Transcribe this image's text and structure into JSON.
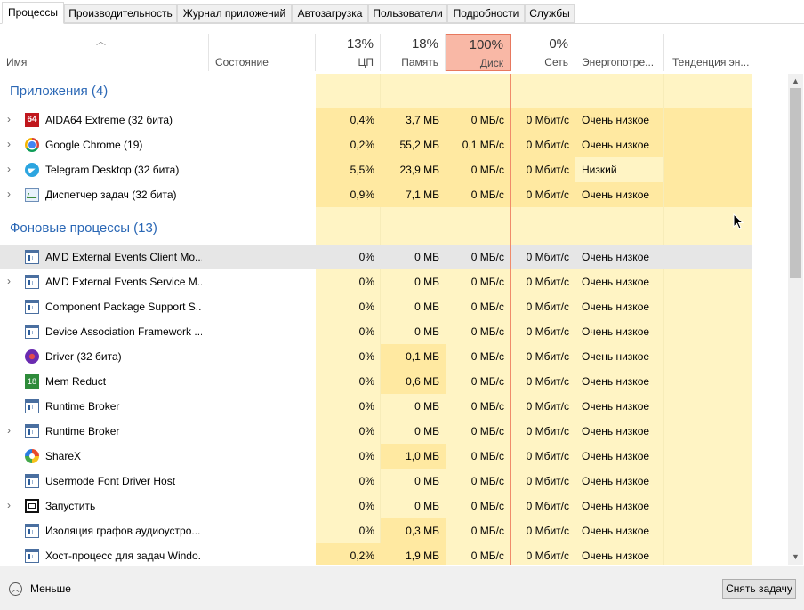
{
  "tabs": [
    {
      "label": "Процессы",
      "active": true
    },
    {
      "label": "Производительность"
    },
    {
      "label": "Журнал приложений"
    },
    {
      "label": "Автозагрузка"
    },
    {
      "label": "Пользователи"
    },
    {
      "label": "Подробности"
    },
    {
      "label": "Службы"
    }
  ],
  "header": {
    "name": "Имя",
    "status": "Состояние",
    "cpu_pct": "13%",
    "cpu": "ЦП",
    "mem_pct": "18%",
    "mem": "Память",
    "disk_pct": "100%",
    "disk": "Диск",
    "net_pct": "0%",
    "net": "Сеть",
    "energy": "Энергопотре...",
    "trend": "Тенденция эн..."
  },
  "groups": {
    "apps": "Приложения (4)",
    "bg": "Фоновые процессы (13)"
  },
  "apps": [
    {
      "name": "AIDA64 Extreme (32 бита)",
      "icon": "aida64-icon",
      "cpu": "0,4%",
      "mem": "3,7 МБ",
      "disk": "0 МБ/с",
      "net": "0 Мбит/с",
      "energy": "Очень низкое"
    },
    {
      "name": "Google Chrome (19)",
      "icon": "chrome-icon",
      "cpu": "0,2%",
      "mem": "55,2 МБ",
      "disk": "0,1 МБ/с",
      "net": "0 Мбит/с",
      "energy": "Очень низкое"
    },
    {
      "name": "Telegram Desktop (32 бита)",
      "icon": "telegram-icon",
      "cpu": "5,5%",
      "mem": "23,9 МБ",
      "disk": "0 МБ/с",
      "net": "0 Мбит/с",
      "energy": "Низкий"
    },
    {
      "name": "Диспетчер задач (32 бита)",
      "icon": "task-manager-icon",
      "cpu": "0,9%",
      "mem": "7,1 МБ",
      "disk": "0 МБ/с",
      "net": "0 Мбит/с",
      "energy": "Очень низкое"
    }
  ],
  "bg": [
    {
      "name": "AMD External Events Client Mo...",
      "icon": "service-icon",
      "cpu": "0%",
      "mem": "0 МБ",
      "disk": "0 МБ/с",
      "net": "0 Мбит/с",
      "energy": "Очень низкое"
    },
    {
      "name": "AMD External Events Service M...",
      "icon": "service-icon",
      "cpu": "0%",
      "mem": "0 МБ",
      "disk": "0 МБ/с",
      "net": "0 Мбит/с",
      "energy": "Очень низкое"
    },
    {
      "name": "Component Package Support S...",
      "icon": "service-icon",
      "cpu": "0%",
      "mem": "0 МБ",
      "disk": "0 МБ/с",
      "net": "0 Мбит/с",
      "energy": "Очень низкое"
    },
    {
      "name": "Device Association Framework ...",
      "icon": "service-icon",
      "cpu": "0%",
      "mem": "0 МБ",
      "disk": "0 МБ/с",
      "net": "0 Мбит/с",
      "energy": "Очень низкое"
    },
    {
      "name": "Driver (32 бита)",
      "icon": "driver-icon",
      "cpu": "0%",
      "mem": "0,1 МБ",
      "disk": "0 МБ/с",
      "net": "0 Мбит/с",
      "energy": "Очень низкое"
    },
    {
      "name": "Mem Reduct",
      "icon": "mem-reduct-icon",
      "cpu": "0%",
      "mem": "0,6 МБ",
      "disk": "0 МБ/с",
      "net": "0 Мбит/с",
      "energy": "Очень низкое"
    },
    {
      "name": "Runtime Broker",
      "icon": "service-icon",
      "cpu": "0%",
      "mem": "0 МБ",
      "disk": "0 МБ/с",
      "net": "0 Мбит/с",
      "energy": "Очень низкое"
    },
    {
      "name": "Runtime Broker",
      "icon": "service-icon",
      "cpu": "0%",
      "mem": "0 МБ",
      "disk": "0 МБ/с",
      "net": "0 Мбит/с",
      "energy": "Очень низкое"
    },
    {
      "name": "ShareX",
      "icon": "sharex-icon",
      "cpu": "0%",
      "mem": "1,0 МБ",
      "disk": "0 МБ/с",
      "net": "0 Мбит/с",
      "energy": "Очень низкое"
    },
    {
      "name": "Usermode Font Driver Host",
      "icon": "service-icon",
      "cpu": "0%",
      "mem": "0 МБ",
      "disk": "0 МБ/с",
      "net": "0 Мбит/с",
      "energy": "Очень низкое"
    },
    {
      "name": "Запустить",
      "icon": "run-icon",
      "cpu": "0%",
      "mem": "0 МБ",
      "disk": "0 МБ/с",
      "net": "0 Мбит/с",
      "energy": "Очень низкое"
    },
    {
      "name": "Изоляция графов аудиоустро...",
      "icon": "service-icon",
      "cpu": "0%",
      "mem": "0,3 МБ",
      "disk": "0 МБ/с",
      "net": "0 Мбит/с",
      "energy": "Очень низкое"
    },
    {
      "name": "Хост-процесс для задач Windo...",
      "icon": "service-icon",
      "cpu": "0,2%",
      "mem": "1,9 МБ",
      "disk": "0 МБ/с",
      "net": "0 Мбит/с",
      "energy": "Очень низкое"
    }
  ],
  "footer": {
    "less": "Меньше",
    "end_task": "Снять задачу"
  },
  "colors": {
    "group_title": "#2a67b5",
    "disk_header": "#f9b8a6",
    "cell_bg": "#fff4c4",
    "cell_hi": "#ffe9a1"
  }
}
